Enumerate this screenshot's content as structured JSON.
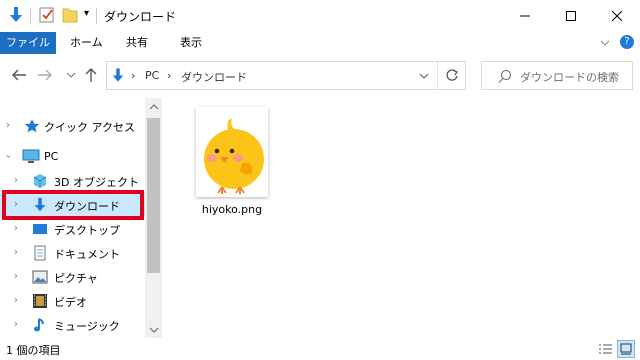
{
  "window": {
    "title": "ダウンロード",
    "qat_dropdown": "▾"
  },
  "ribbon": {
    "tabs": [
      {
        "label": "ファイル"
      },
      {
        "label": "ホーム"
      },
      {
        "label": "共有"
      },
      {
        "label": "表示"
      }
    ]
  },
  "address": {
    "segments": [
      "PC",
      "ダウンロード"
    ],
    "separator": "›"
  },
  "search": {
    "placeholder": "ダウンロードの検索"
  },
  "sidebar": {
    "items": [
      {
        "label": "クイック アクセス",
        "icon": "star-icon"
      },
      {
        "label": "PC",
        "icon": "pc-icon"
      },
      {
        "label": "3D オブジェクト",
        "icon": "3d-objects-icon"
      },
      {
        "label": "ダウンロード",
        "icon": "download-icon"
      },
      {
        "label": "デスクトップ",
        "icon": "desktop-icon"
      },
      {
        "label": "ドキュメント",
        "icon": "document-icon"
      },
      {
        "label": "ピクチャ",
        "icon": "pictures-icon"
      },
      {
        "label": "ビデオ",
        "icon": "video-icon"
      },
      {
        "label": "ミュージック",
        "icon": "music-icon"
      }
    ]
  },
  "content": {
    "files": [
      {
        "name": "hiyoko.png"
      }
    ]
  },
  "status": {
    "count_text": "1 個の項目"
  },
  "colors": {
    "accent": "#1a6fc2",
    "selection": "#cce8ff",
    "highlight_border": "#e0001b"
  }
}
